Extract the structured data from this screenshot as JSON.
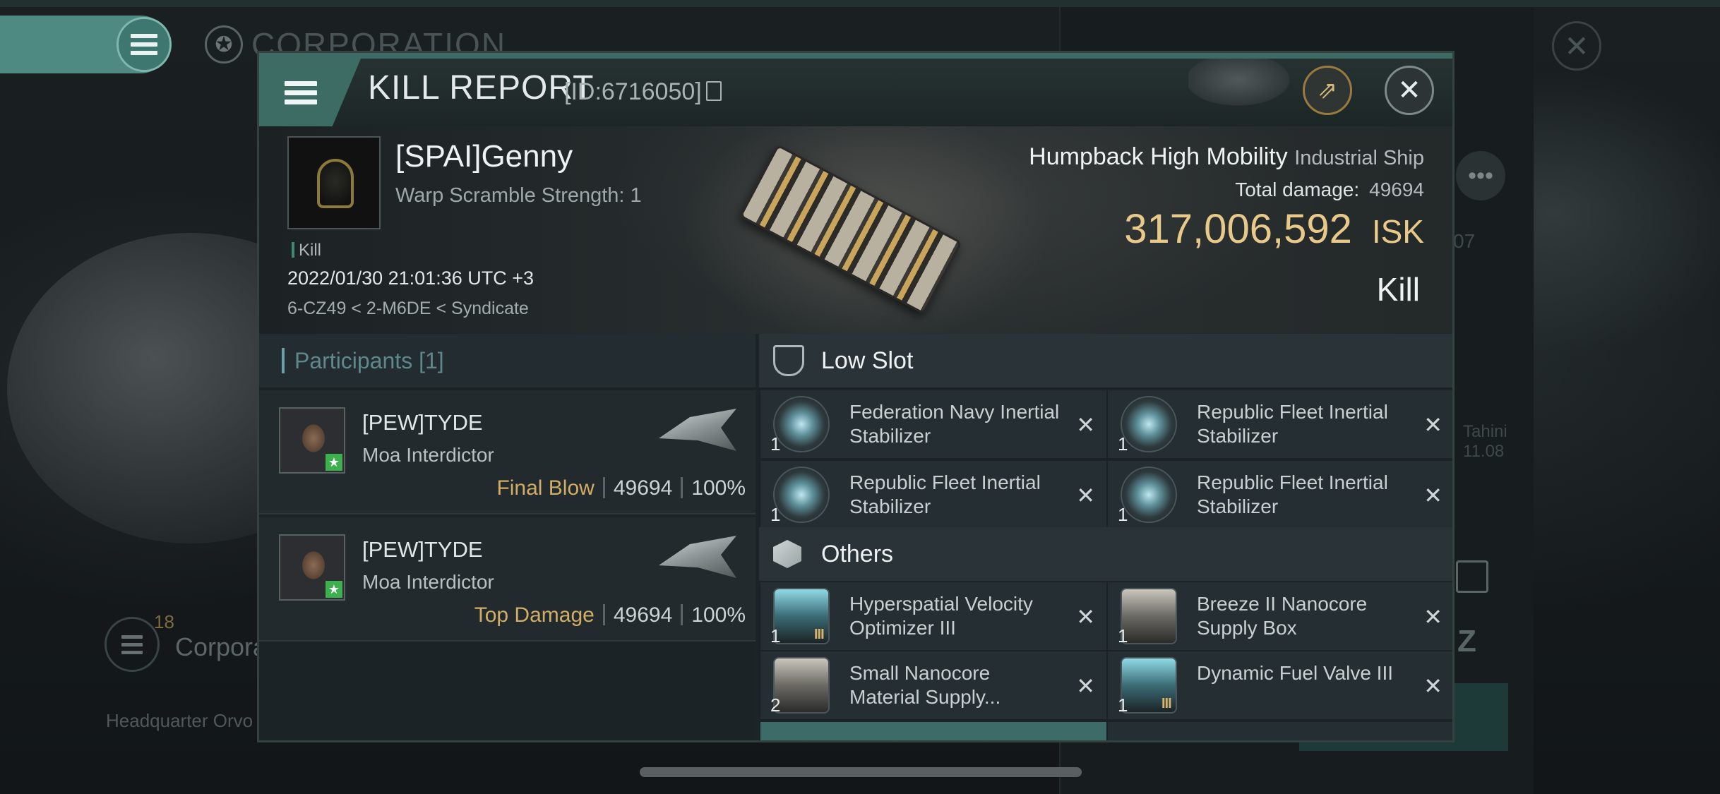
{
  "background": {
    "corp_title": "CORPORATION",
    "corp_label": "Corpora",
    "badge": "18",
    "headquarter": "Headquarter Orvo",
    "right_num": "07",
    "right_note": [
      "Tahini",
      "11.08"
    ]
  },
  "modal": {
    "title": "KILL REPORT",
    "id_label": "[ID:6716050]"
  },
  "victim": {
    "name": "[SPAI]Genny",
    "warp": "Warp Scramble Strength: 1",
    "tag": "Kill",
    "datetime": "2022/01/30 21:01:36 UTC +3",
    "location": "6-CZ49 < 2-M6DE < Syndicate",
    "ship_name": "Humpback High Mobility",
    "ship_class": "Industrial Ship",
    "damage_label": "Total damage:",
    "damage_value": "49694",
    "isk_value": "317,006,592",
    "isk_unit": "ISK",
    "result": "Kill"
  },
  "participants": {
    "header": "Participants [1]",
    "rows": [
      {
        "name": "[PEW]TYDE",
        "ship": "Moa Interdictor",
        "role": "Final Blow",
        "damage": "49694",
        "percent": "100%"
      },
      {
        "name": "[PEW]TYDE",
        "ship": "Moa Interdictor",
        "role": "Top Damage",
        "damage": "49694",
        "percent": "100%"
      }
    ]
  },
  "items": {
    "low_slot_title": "Low Slot",
    "others_title": "Others",
    "low": [
      {
        "name": "Federation Navy Inertial Stabilizer",
        "qty": "1"
      },
      {
        "name": "Republic Fleet Inertial Stabilizer",
        "qty": "1"
      },
      {
        "name": "Republic Fleet Inertial Stabilizer",
        "qty": "1"
      },
      {
        "name": "Republic Fleet Inertial Stabilizer",
        "qty": "1"
      }
    ],
    "others": [
      {
        "name": "Hyperspatial Velocity Optimizer III",
        "qty": "1",
        "tech": "III"
      },
      {
        "name": "Breeze II Nanocore Supply Box",
        "qty": "1",
        "tech": ""
      },
      {
        "name": "Small Nanocore Material Supply...",
        "qty": "2",
        "tech": ""
      },
      {
        "name": "Dynamic Fuel Valve III",
        "qty": "1",
        "tech": "III"
      }
    ],
    "close_glyph": "✕"
  }
}
